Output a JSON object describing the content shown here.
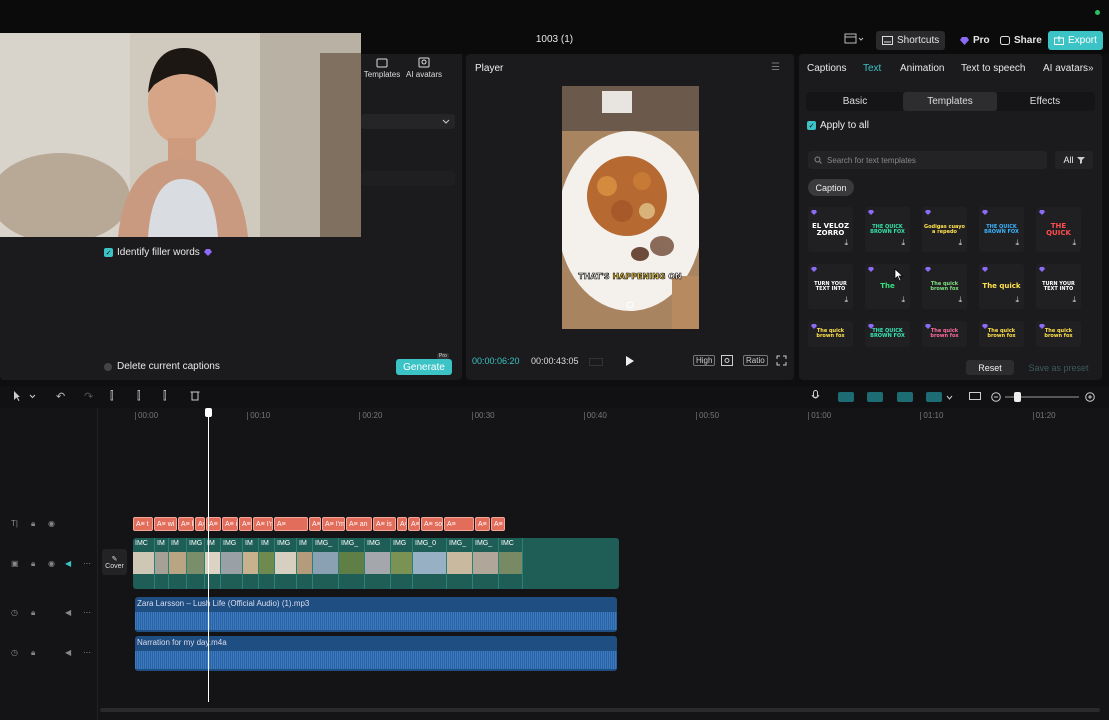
{
  "window": {
    "title": "1003 (1)"
  },
  "header": {
    "shortcuts": "Shortcuts",
    "pro": "Pro",
    "share": "Share",
    "export": "Export"
  },
  "left_panel": {
    "tabs": [
      {
        "label": "Templates"
      },
      {
        "label": "AI avatars"
      }
    ],
    "identify_filler": "Identify filler words",
    "delete_captions": "Delete current captions",
    "generate": "Generate",
    "generate_badge": "Pro"
  },
  "player": {
    "title": "Player",
    "current_time": "00:00:06:20",
    "total_time": "00:00:43:05",
    "quality": "High",
    "ratio": "Ratio",
    "overlay_text_1": "THAT'S",
    "overlay_text_2": "HAPPENING",
    "overlay_text_3": "ON"
  },
  "right_panel": {
    "tabs": [
      "Captions",
      "Text",
      "Animation",
      "Text to speech",
      "AI avatars"
    ],
    "active_tab": "Text",
    "segments": [
      "Basic",
      "Templates",
      "Effects"
    ],
    "apply_all": "Apply to all",
    "search_placeholder": "Search for text templates",
    "filter": "All",
    "chip": "Caption",
    "templates": [
      {
        "text": "EL VELOZ ZORRO",
        "color": "#ffffff"
      },
      {
        "text": "THE QUICK BROWN FOX",
        "color": "#35e3a6"
      },
      {
        "text": "Godigas cuayo a repedo",
        "color": "#ffe14d"
      },
      {
        "text": "THE QUICK BROWN FOX",
        "color": "#3bb4ff"
      },
      {
        "text": "THE QUICK",
        "color": "#ff4d4d"
      },
      {
        "text": "TURN YOUR TEXT INTO",
        "color": "#ffffff"
      },
      {
        "text": "The",
        "color": "#37e37d"
      },
      {
        "text": "The quick brown fox",
        "color": "#7de37f"
      },
      {
        "text": "The quick",
        "color": "#ffe14d"
      },
      {
        "text": "TURN YOUR TEXT INTO",
        "color": "#ffffff"
      },
      {
        "text": "The quick brown fox",
        "color": "#ffe14d"
      },
      {
        "text": "THE QUICK BROWN FOX",
        "color": "#37e3b0"
      },
      {
        "text": "The quick brown fox",
        "color": "#ff6b9b"
      },
      {
        "text": "The quick brown fox",
        "color": "#ffe14d"
      },
      {
        "text": "The quick brown fox",
        "color": "#ffe14d"
      }
    ],
    "reset": "Reset",
    "save_preset": "Save as preset"
  },
  "timeline": {
    "ticks": [
      "00:00",
      "00:10",
      "00:20",
      "00:30",
      "00:40",
      "00:50",
      "01:00",
      "01:10",
      "01:20"
    ],
    "captions": [
      "A≡ t",
      "A≡ wi",
      "A≡ b",
      "A≡",
      "A≡",
      "A≡ is",
      "A≡ a",
      "A≡ I'm t",
      "A≡",
      "A≡ an",
      "A≡ I'm",
      "A≡ an",
      "A≡ is",
      "A≡ t",
      "A≡ ar",
      "A≡ so",
      "A≡",
      "A≡ here's",
      "A≡ no"
    ],
    "video_clips": [
      "IMC",
      "IM",
      "IM",
      "IMG",
      "IM",
      "IMG",
      "IM",
      "IM",
      "IMG",
      "IM",
      "IMG_",
      "IMG_",
      "IMG",
      "IMG",
      "IMG_0",
      "IMG_",
      "IMG_",
      "IMC"
    ],
    "cover": "Cover",
    "audio_1": "Zara Larsson – Lush Life (Official Audio) (1).mp3",
    "audio_2": "Narration for my day.m4a"
  }
}
